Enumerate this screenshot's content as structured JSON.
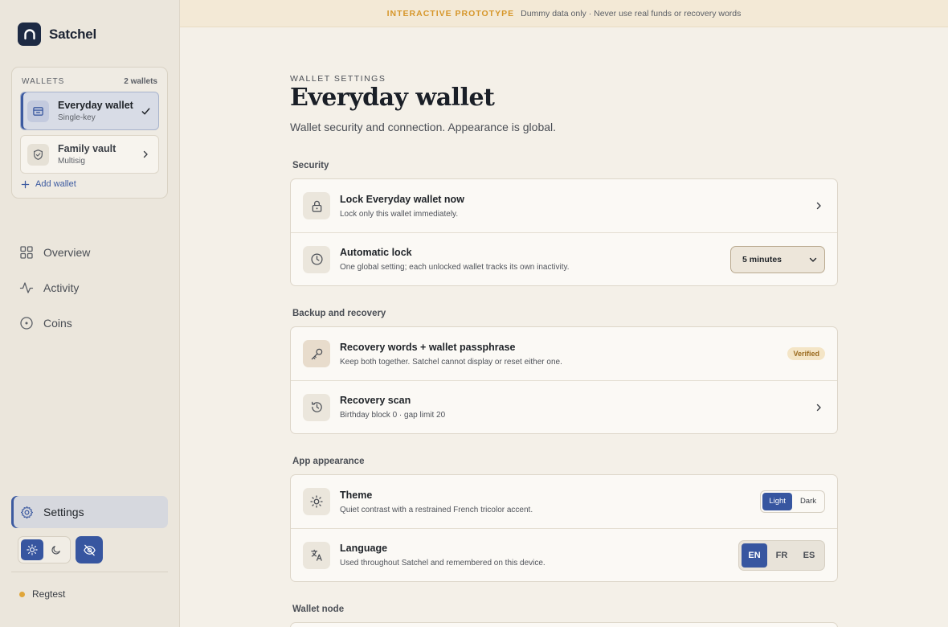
{
  "app": {
    "name": "Satchel"
  },
  "banner": {
    "tag": "INTERACTIVE PROTOTYPE",
    "message": "Dummy data only · Never use real funds or recovery words"
  },
  "wallets": {
    "label": "WALLETS",
    "count": "2 wallets",
    "items": [
      {
        "name": "Everyday wallet",
        "type": "Single-key",
        "icon": "wallet-icon",
        "active": true
      },
      {
        "name": "Family vault",
        "type": "Multisig",
        "icon": "shield-icon",
        "active": false
      }
    ],
    "add_label": "Add wallet"
  },
  "nav": {
    "items": [
      {
        "label": "Overview",
        "icon": "grid-icon"
      },
      {
        "label": "Activity",
        "icon": "activity-icon"
      },
      {
        "label": "Coins",
        "icon": "coin-icon"
      }
    ]
  },
  "settings_label": "Settings",
  "network": "Regtest",
  "page": {
    "eyebrow": "WALLET SETTINGS",
    "title": "Everyday wallet",
    "subtitle": "Wallet security and connection. Appearance is global."
  },
  "sections": {
    "security": {
      "label": "Security",
      "lock": {
        "title": "Lock Everyday wallet now",
        "desc": "Lock only this wallet immediately."
      },
      "autolock": {
        "title": "Automatic lock",
        "desc": "One global setting; each unlocked wallet tracks its own inactivity.",
        "value": "5 minutes"
      }
    },
    "backup": {
      "label": "Backup and recovery",
      "words": {
        "title": "Recovery words + wallet passphrase",
        "desc": "Keep both together. Satchel cannot display or reset either one.",
        "badge": "Verified"
      },
      "scan": {
        "title": "Recovery scan",
        "desc": "Birthday block 0 · gap limit 20"
      }
    },
    "appearance": {
      "label": "App appearance",
      "theme": {
        "title": "Theme",
        "desc": "Quiet contrast with a restrained French tricolor accent.",
        "options": [
          "Light",
          "Dark"
        ],
        "selected": "Light"
      },
      "language": {
        "title": "Language",
        "desc": "Used throughout Satchel and remembered on this device.",
        "options": [
          "EN",
          "FR",
          "ES"
        ],
        "selected": "EN"
      }
    },
    "node": {
      "label": "Wallet node"
    }
  },
  "colors": {
    "accent": "#3756a0",
    "navy": "#1d2a44",
    "warning": "#d6962a",
    "network_dot": "#e0a63a"
  }
}
